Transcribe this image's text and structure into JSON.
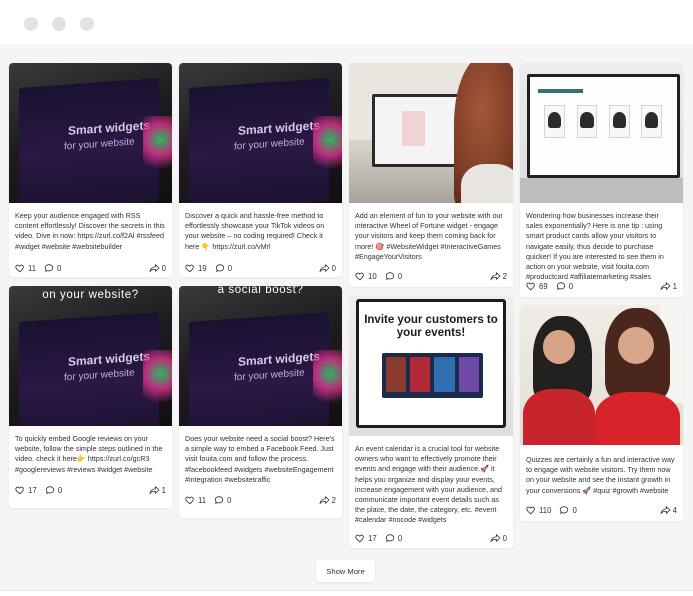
{
  "window": {
    "controls": [
      "close",
      "minimize",
      "maximize"
    ]
  },
  "feed": {
    "show_more_label": "Show More",
    "posts": [
      {
        "caption": "Keep your audience engaged with RSS content effortlessly! Discover the secrets in this video. Dive in now: https://zurl.co/f2Al #rssfeed #widget #website #websitebuilder",
        "overlay": "",
        "likes": "11",
        "comments": "0",
        "shares": "0"
      },
      {
        "caption": "Discover a quick and hassle-free method to effortlessly showcase your TikTok videos on your website – no coding required! Check it here 👇 https://zurl.co/vMrl",
        "overlay": "",
        "likes": "19",
        "comments": "0",
        "shares": "0"
      },
      {
        "caption": "Add an element of fun to your website with our interactive Wheel of Fortune widget - engage your visitors and keep them coming back for more! 🎯 #WebsiteWidget #InteractiveGames #EngageYourVisitors",
        "overlay": "",
        "likes": "10",
        "comments": "0",
        "shares": "2"
      },
      {
        "caption": "Wondering how businesses increase their sales exponentially? Here is one tip : using smart product cards allow your visitors to navigate easily, thus decide to purchase quicker! If you are interested to see them in action on your website, visit fouita.com #productcard #affiliatemarketing #sales",
        "overlay": "",
        "likes": "69",
        "comments": "0",
        "shares": "1"
      },
      {
        "caption": "To quickly embed Google reviews on your website, follow the simple steps outlined in the video. check it here👉 https://zurl.co/gcR3 #googlereviews #reviews #widget #website",
        "overlay": "on your website?",
        "likes": "17",
        "comments": "0",
        "shares": "1"
      },
      {
        "caption": "Does your website need a social boost? Here's a simple way to embed a Facebook Feed. Just visit fouita.com and follow the process. #facebookfeed #widgets #websiteEngagement #integration #websitetraffic",
        "overlay": "a social boost?",
        "likes": "11",
        "comments": "0",
        "shares": "2"
      },
      {
        "caption": "An event calendar is a crucial tool for website owners who want to effectively promote their events and engage with their audience.🚀 it helps you organize and display your events, increase engagement with your audience, and communicate important event details such as the place, the date, the category, etc. #event #calendar #nocode #widgets",
        "overlay": "Invite your customers to your events!",
        "likes": "17",
        "comments": "0",
        "shares": "0"
      },
      {
        "caption": "Quizzes are certainly a fun and interactive way to engage with website visitors. Try them now on your website and see the instant growth in your conversions 🚀 #quiz #growth #website",
        "overlay": "",
        "likes": "110",
        "comments": "0",
        "shares": "4"
      }
    ]
  },
  "thumbnail_text": {
    "brand_line_1": "Smart widgets",
    "brand_line_2": "for your website"
  },
  "colors": {
    "background": "#f5f5f5",
    "card": "#ffffff",
    "text": "#333333",
    "dots": "#e2e2e2"
  }
}
